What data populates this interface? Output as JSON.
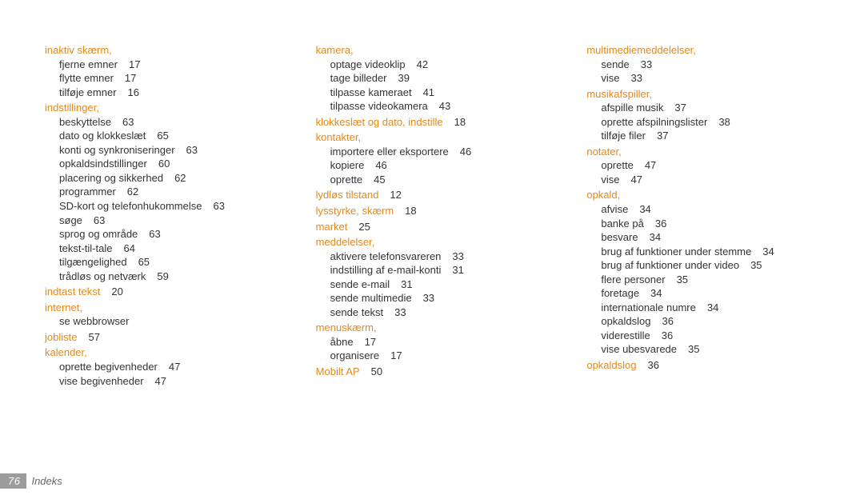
{
  "footer": {
    "page": "76",
    "title": "Indeks"
  },
  "col1": {
    "s1": {
      "h": "inaktiv skærm,",
      "e": [
        [
          "fjerne emner",
          "17"
        ],
        [
          "flytte emner",
          "17"
        ],
        [
          "tilføje emner",
          "16"
        ]
      ]
    },
    "s2": {
      "h": "indstillinger,",
      "e": [
        [
          "beskyttelse",
          "63"
        ],
        [
          "dato og klokkeslæt",
          "65"
        ],
        [
          "konti og synkroniseringer",
          "63"
        ],
        [
          "opkaldsindstillinger",
          "60"
        ],
        [
          "placering og sikkerhed",
          "62"
        ],
        [
          "programmer",
          "62"
        ],
        [
          "SD-kort og telefonhukommelse",
          "63"
        ],
        [
          "søge",
          "63"
        ],
        [
          "sprog og område",
          "63"
        ],
        [
          "tekst-til-tale",
          "64"
        ],
        [
          "tilgængelighed",
          "65"
        ],
        [
          "trådløs og netværk",
          "59"
        ]
      ]
    },
    "s3": {
      "h": "indtast tekst",
      "pg": "20"
    },
    "s4": {
      "h": "internet,",
      "e": [
        [
          "se webbrowser",
          ""
        ]
      ]
    },
    "s5": {
      "h": "jobliste",
      "pg": "57"
    },
    "s6": {
      "h": "kalender,",
      "e": [
        [
          "oprette begivenheder",
          "47"
        ],
        [
          "vise begivenheder",
          "47"
        ]
      ]
    }
  },
  "col2": {
    "s1": {
      "h": "kamera,",
      "e": [
        [
          "optage videoklip",
          "42"
        ],
        [
          "tage billeder",
          "39"
        ],
        [
          "tilpasse kameraet",
          "41"
        ],
        [
          "tilpasse videokamera",
          "43"
        ]
      ]
    },
    "s2": {
      "h": "klokkeslæt og dato, indstille",
      "pg": "18"
    },
    "s3": {
      "h": "kontakter,",
      "e": [
        [
          "importere eller eksportere",
          "46"
        ],
        [
          "kopiere",
          "46"
        ],
        [
          "oprette",
          "45"
        ]
      ]
    },
    "s4": {
      "h": "lydløs tilstand",
      "pg": "12"
    },
    "s5": {
      "h": "lysstyrke, skærm",
      "pg": "18"
    },
    "s6": {
      "h": "market",
      "pg": "25"
    },
    "s7": {
      "h": "meddelelser,",
      "e": [
        [
          "aktivere telefonsvareren",
          "33"
        ],
        [
          "indstilling af e-mail-konti",
          "31"
        ],
        [
          "sende e-mail",
          "31"
        ],
        [
          "sende multimedie",
          "33"
        ],
        [
          "sende tekst",
          "33"
        ]
      ]
    },
    "s8": {
      "h": "menuskærm,",
      "e": [
        [
          "åbne",
          "17"
        ],
        [
          "organisere",
          "17"
        ]
      ]
    },
    "s9": {
      "h": "Mobilt AP",
      "pg": "50"
    }
  },
  "col3": {
    "s1": {
      "h": "multimediemeddelelser,",
      "e": [
        [
          "sende",
          "33"
        ],
        [
          "vise",
          "33"
        ]
      ]
    },
    "s2": {
      "h": "musikafspiller,",
      "e": [
        [
          "afspille musik",
          "37"
        ],
        [
          "oprette afspilningslister",
          "38"
        ],
        [
          "tilføje filer",
          "37"
        ]
      ]
    },
    "s3": {
      "h": "notater,",
      "e": [
        [
          "oprette",
          "47"
        ],
        [
          "vise",
          "47"
        ]
      ]
    },
    "s4": {
      "h": "opkald,",
      "e": [
        [
          "afvise",
          "34"
        ],
        [
          "banke på",
          "36"
        ],
        [
          "besvare",
          "34"
        ],
        [
          "brug af funktioner under stemme",
          "34"
        ],
        [
          "brug af funktioner under video",
          "35"
        ],
        [
          "flere personer",
          "35"
        ],
        [
          "foretage",
          "34"
        ],
        [
          "internationale numre",
          "34"
        ],
        [
          "opkaldslog",
          "36"
        ],
        [
          "viderestille",
          "36"
        ],
        [
          "vise ubesvarede",
          "35"
        ]
      ]
    },
    "s5": {
      "h": "opkaldslog",
      "pg": "36"
    }
  }
}
